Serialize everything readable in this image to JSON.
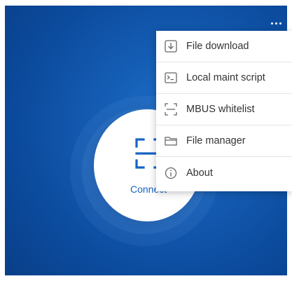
{
  "header": {
    "more_icon": "more-horizontal-icon"
  },
  "connect": {
    "label": "Connect",
    "icon": "scan-frame-icon",
    "color": "#1664c3"
  },
  "menu": {
    "items": [
      {
        "label": "File download",
        "icon": "download-icon"
      },
      {
        "label": "Local maint script",
        "icon": "terminal-icon"
      },
      {
        "label": "MBUS whitelist",
        "icon": "scan-frame-icon"
      },
      {
        "label": "File manager",
        "icon": "folder-icon"
      },
      {
        "label": "About",
        "icon": "info-icon"
      }
    ]
  },
  "colors": {
    "background": "#0b4a9c",
    "accent": "#1664c3",
    "menu_text": "#333333"
  }
}
